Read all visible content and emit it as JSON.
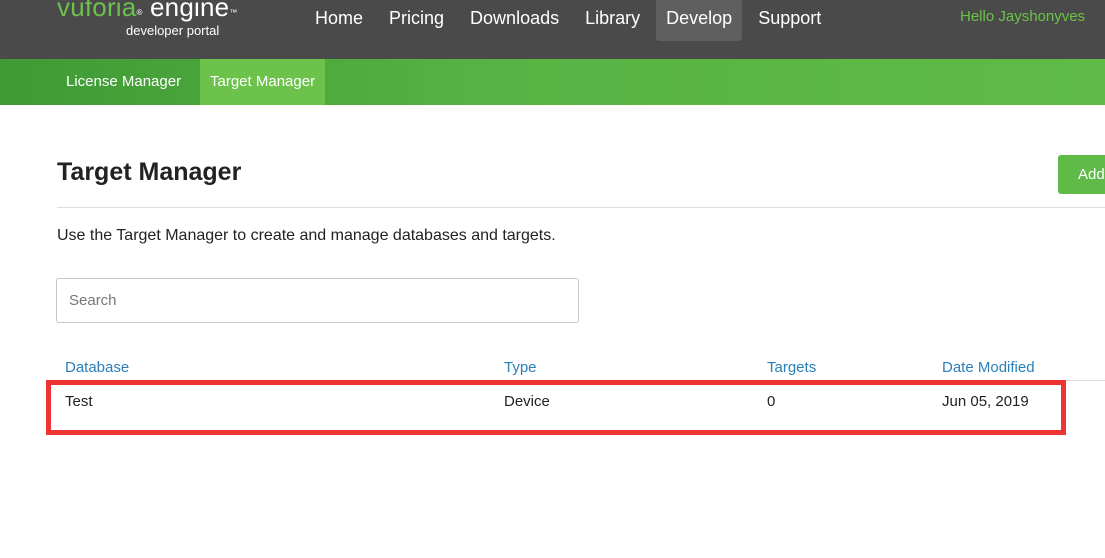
{
  "header": {
    "logo_brand": "vuforia",
    "logo_reg": "®",
    "logo_product": "engine",
    "logo_tm": "™",
    "logo_sub": "developer portal",
    "nav": [
      {
        "label": "Home"
      },
      {
        "label": "Pricing"
      },
      {
        "label": "Downloads"
      },
      {
        "label": "Library"
      },
      {
        "label": "Develop",
        "active": true
      },
      {
        "label": "Support"
      }
    ],
    "greeting": "Hello Jayshonyves"
  },
  "subnav": {
    "items": [
      {
        "label": "License Manager"
      },
      {
        "label": "Target Manager",
        "active": true
      }
    ]
  },
  "main": {
    "title": "Target Manager",
    "add_button": "Add Database",
    "description": "Use the Target Manager to create and manage databases and targets.",
    "search_placeholder": "Search",
    "table": {
      "columns": [
        "Database",
        "Type",
        "Targets",
        "Date Modified"
      ],
      "rows": [
        [
          "Test",
          "Device",
          "0",
          "Jun 05, 2019"
        ]
      ]
    }
  },
  "colors": {
    "header_bg": "#4a4a4a",
    "brand_green": "#6cc24a",
    "link_blue": "#2a7fb8",
    "highlight_red": "#ee3333"
  }
}
